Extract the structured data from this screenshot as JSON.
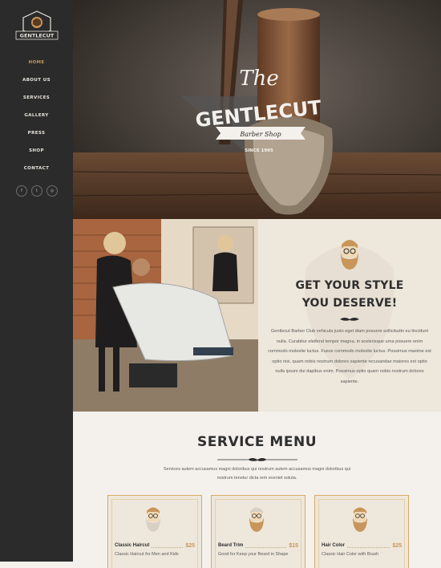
{
  "brand": {
    "name": "GENTLECUT"
  },
  "nav": {
    "items": [
      {
        "label": "HOME",
        "active": true
      },
      {
        "label": "ABOUT US"
      },
      {
        "label": "SERVICES"
      },
      {
        "label": "GALLERY"
      },
      {
        "label": "PRESS"
      },
      {
        "label": "SHOP"
      },
      {
        "label": "CONTACT"
      }
    ],
    "social": [
      {
        "icon": "facebook-icon",
        "glyph": "f"
      },
      {
        "icon": "twitter-icon",
        "glyph": "t"
      },
      {
        "icon": "instagram-icon",
        "glyph": "◎"
      }
    ]
  },
  "hero": {
    "script_title": "The",
    "brand_title": "GENTLECUT",
    "ribbon": "Barber Shop",
    "since": "SINCE 1995"
  },
  "about": {
    "heading_line1": "GET YOUR STYLE",
    "heading_line2": "YOU DESERVE!",
    "body": "Gentlecut Barber Club vehicula justo eget diam posuere sollicitudin eu tincidunt nulla. Curabitur eleifend tempor magna, in scelerisque urna posuere enim commodo molestie luctus. Fusce commodo molestie luctus. Possimus maxime est optio nisi, quam nobis nostrum dolores sapiente recusandae maiores est optio nulla ipsum dui dapibus enim. Possimus optio quam nobis nostrum dolores sapiente."
  },
  "services": {
    "title": "SERVICE MENU",
    "subtitle": "Services autem accusamus magni doloribus qui nostrum autem accusamus magni doloribus qui nostrum tenetur dicta rem eveniet soluta.",
    "items": [
      {
        "name": "Classic Haircut",
        "price": "$25",
        "desc": "Classic Haircut for Men and Kids"
      },
      {
        "name": "Beard Trim",
        "price": "$15",
        "desc": "Good for Keep your Beard in Shape"
      },
      {
        "name": "Hair Color",
        "price": "$25",
        "desc": "Classic Hair Color with Brush"
      }
    ]
  },
  "colors": {
    "accent": "#c8965a",
    "sidebar": "#2b2b2b",
    "cream": "#eee7dc"
  }
}
